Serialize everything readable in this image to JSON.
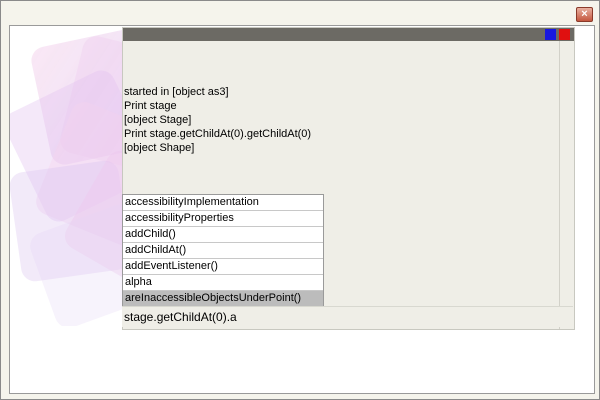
{
  "window": {
    "close_glyph": "×",
    "close_icon": "close-icon"
  },
  "console": {
    "output_lines": [
      "started in [object as3]",
      "Print stage",
      "[object Stage]",
      "Print stage.getChildAt(0).getChildAt(0)",
      "[object Shape]"
    ],
    "suggestions": [
      "accessibilityImplementation",
      "accessibilityProperties",
      "addChild()",
      "addChildAt()",
      "addEventListener()",
      "alpha",
      "areInaccessibleObjectsUnderPoint()"
    ],
    "selected_suggestion": "areInaccessibleObjectsUnderPoint()",
    "input_value": "stage.getChildAt(0).a"
  },
  "colors": {
    "titlebar": "#6c6a64",
    "blue_button": "#1818e0",
    "red_button": "#e01010",
    "selection": "#bcbcbc"
  }
}
